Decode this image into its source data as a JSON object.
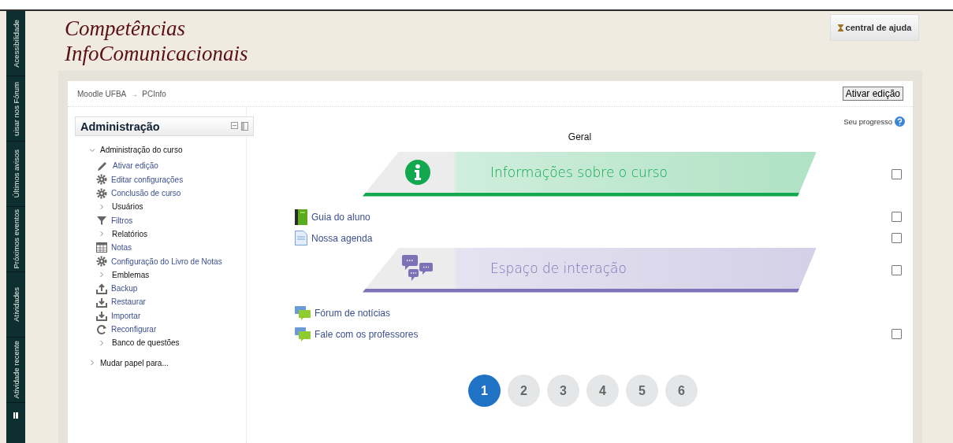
{
  "side_tabs": [
    {
      "kind": "text",
      "label": "Acessibilidade"
    },
    {
      "kind": "text",
      "label": "uisar nos Fórum"
    },
    {
      "kind": "text",
      "label": "Últimos avisos"
    },
    {
      "kind": "text",
      "label": "Próximos eventos"
    },
    {
      "kind": "text",
      "label": "Atividades"
    },
    {
      "kind": "text",
      "label": "Atividade recente"
    },
    {
      "kind": "dock"
    }
  ],
  "site_title": [
    "Competências",
    "InfoComunicacionais"
  ],
  "help_button": "central de ajuda",
  "breadcrumb": [
    "Moodle UFBA",
    "PCInfo"
  ],
  "breadcrumb_separator": "→",
  "edit_button": "Ativar edição",
  "admin_block": {
    "title": "Administração",
    "root": {
      "label": "Administração do curso",
      "expanded": true,
      "children": [
        {
          "kind": "edit",
          "label": "Ativar edição"
        },
        {
          "kind": "settings",
          "label": "Editar configurações"
        },
        {
          "kind": "settings",
          "label": "Conclusão de curso"
        },
        {
          "kind": "branch",
          "label": "Usuários"
        },
        {
          "kind": "filter",
          "label": "Filtros"
        },
        {
          "kind": "branch",
          "label": "Relatórios"
        },
        {
          "kind": "grades",
          "label": "Notas"
        },
        {
          "kind": "settings",
          "label": "Configuração do Livro de Notas"
        },
        {
          "kind": "branch",
          "label": "Emblemas"
        },
        {
          "kind": "backup",
          "label": "Backup"
        },
        {
          "kind": "restore",
          "label": "Restaurar"
        },
        {
          "kind": "restore",
          "label": "Importar"
        },
        {
          "kind": "reset",
          "label": "Reconfigurar"
        },
        {
          "kind": "branch",
          "label": "Banco de questões"
        }
      ]
    },
    "other": {
      "label": "Mudar papel para...",
      "expanded": false
    }
  },
  "progress_label": "Seu progresso",
  "section_title": "Geral",
  "content": [
    {
      "kind": "infobanner",
      "title": "Informações sobre o curso",
      "color": "#11a84f",
      "checked": false
    },
    {
      "kind": "book",
      "label": "Guia do aluno",
      "checked": false
    },
    {
      "kind": "page",
      "label": "Nossa agenda",
      "checked": false
    },
    {
      "kind": "chatbanner",
      "title": "Espaço de interação",
      "color": "#7d72b8",
      "checked": false
    },
    {
      "kind": "forum",
      "label": "Fórum de notícias"
    },
    {
      "kind": "forum",
      "label": "Fale com os professores",
      "checked": false
    }
  ],
  "pages": [
    {
      "label": "1",
      "selected": true
    },
    {
      "label": "2",
      "selected": false
    },
    {
      "label": "3",
      "selected": false
    },
    {
      "label": "4",
      "selected": false
    },
    {
      "label": "5",
      "selected": false
    },
    {
      "label": "6",
      "selected": false
    }
  ]
}
